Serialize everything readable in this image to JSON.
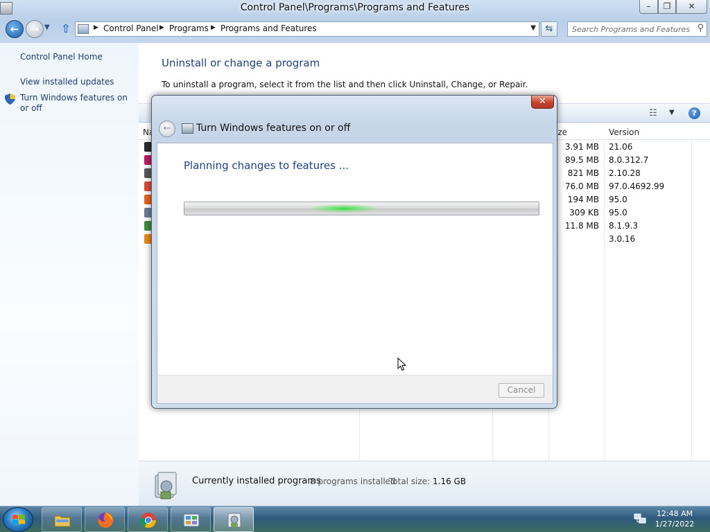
{
  "window": {
    "title": "Control Panel\\Programs\\Programs and Features",
    "min_label": "–",
    "max_label": "❐",
    "close_label": "✕"
  },
  "nav": {
    "back_glyph": "←",
    "forward_glyph": "→",
    "breadcrumbs": [
      "Control Panel",
      "Programs",
      "Programs and Features"
    ],
    "search_placeholder": "Search Programs and Features"
  },
  "sidebar": {
    "items": [
      {
        "label": "Control Panel Home"
      },
      {
        "label": "View installed updates"
      },
      {
        "label": "Turn Windows features on or off"
      }
    ]
  },
  "main": {
    "title": "Uninstall or change a program",
    "description": "To uninstall a program, select it from the list and then click Uninstall, Change, or Repair.",
    "columns": {
      "name": "Na",
      "size": "ize",
      "version": "Version"
    },
    "rows": [
      {
        "size": "3.91 MB",
        "version": "21.06",
        "icon_color": "#2c2c2c"
      },
      {
        "size": "89.5 MB",
        "version": "8.0.312.7",
        "icon_color": "#c0186a"
      },
      {
        "size": "821 MB",
        "version": "2.10.28",
        "icon_color": "#5a5a5a"
      },
      {
        "size": "76.0 MB",
        "version": "97.0.4692.99",
        "icon_color": "#dd4b39"
      },
      {
        "size": "194 MB",
        "version": "95.0",
        "icon_color": "#e8631b"
      },
      {
        "size": "309 KB",
        "version": "95.0",
        "icon_color": "#6b7f95"
      },
      {
        "size": "11.8 MB",
        "version": "8.1.9.3",
        "icon_color": "#3f8f3f"
      },
      {
        "size": "",
        "version": "3.0.16",
        "icon_color": "#e88a12"
      }
    ]
  },
  "status": {
    "main": "Currently installed programs",
    "count": "8 programs installed",
    "total_label": "Total size:",
    "total": "1.16 GB"
  },
  "dialog": {
    "title": "Turn Windows features on or off",
    "heading": "Planning changes to features ...",
    "cancel_label": "Cancel",
    "close_label": "✕",
    "back_glyph": "←",
    "progress_mode": "marquee",
    "progress_glow_position": 0.45
  },
  "taskbar": {
    "items": [
      {
        "name": "explorer"
      },
      {
        "name": "firefox"
      },
      {
        "name": "chrome"
      },
      {
        "name": "control-panel"
      },
      {
        "name": "programs-and-features",
        "active": true
      }
    ],
    "clock_time": "12:48 AM",
    "clock_date": "1/27/2022"
  }
}
